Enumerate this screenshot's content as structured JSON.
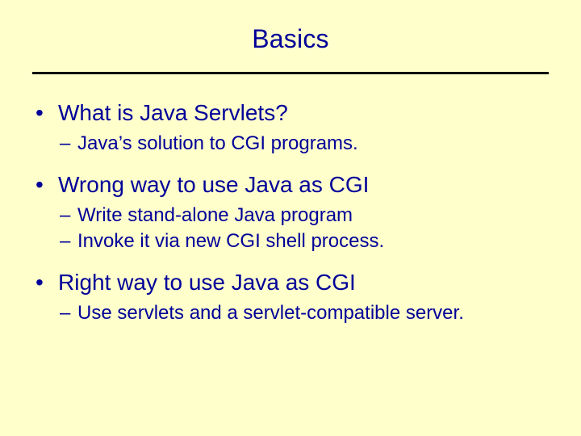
{
  "title": "Basics",
  "items": [
    {
      "label": "What is Java Servlets?",
      "sub": [
        "Java’s solution to CGI programs."
      ]
    },
    {
      "label": "Wrong way to use Java as CGI",
      "sub": [
        "Write stand-alone Java program",
        "Invoke it via new CGI shell process."
      ]
    },
    {
      "label": "Right way to use Java as CGI",
      "sub": [
        "Use servlets and a servlet-compatible server."
      ]
    }
  ]
}
